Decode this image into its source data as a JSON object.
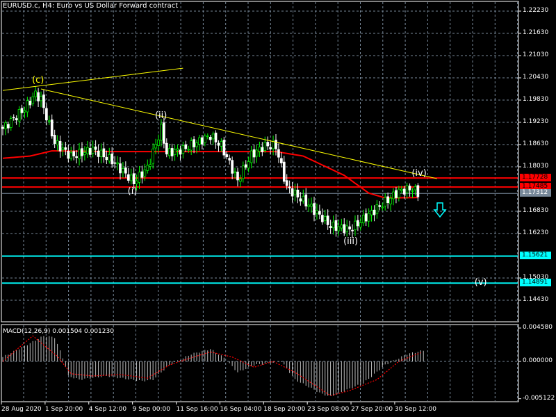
{
  "header": {
    "title": "EURUSD.c, H4:  Euro vs US Dollar Forward contract"
  },
  "colors": {
    "bull": "#00ff00",
    "bear": "#ffffff",
    "ma": "#ff0000",
    "trend": "#ffff00",
    "support": "#00ffff",
    "level": "#ff0000",
    "bid": "#778899",
    "grid": "#778899"
  },
  "price_axis": [
    "1.22230",
    "1.21630",
    "1.21030",
    "1.20430",
    "1.19830",
    "1.19230",
    "1.18630",
    "1.18030",
    "1.16830",
    "1.16230",
    "1.15030",
    "1.14430"
  ],
  "price_axis_values": [
    1.2223,
    1.2163,
    1.2103,
    1.2043,
    1.1983,
    1.1923,
    1.1863,
    1.1803,
    1.1683,
    1.1623,
    1.1503,
    1.1443
  ],
  "levels": [
    {
      "label": "1.17728",
      "value": 1.17728,
      "kind": "level"
    },
    {
      "label": "1.17485",
      "value": 1.17485,
      "kind": "level"
    },
    {
      "label": "1.17312",
      "value": 1.17312,
      "kind": "bid"
    },
    {
      "label": "1.15621",
      "value": 1.15621,
      "kind": "support"
    },
    {
      "label": "1.14891",
      "value": 1.14891,
      "kind": "support"
    }
  ],
  "waves": [
    {
      "label": "(c)",
      "bar": 13,
      "price": 1.2035,
      "color": "#ffff00"
    },
    {
      "label": "(ii)",
      "bar": 58,
      "price": 1.194,
      "color": "#ffffff"
    },
    {
      "label": "(i)",
      "bar": 48,
      "price": 1.1735,
      "color": "#ffffff"
    },
    {
      "label": "(iii)",
      "bar": 127,
      "price": 1.16,
      "color": "#ffffff"
    },
    {
      "label": "(iv)",
      "bar": 152,
      "price": 1.1785,
      "color": "#ffffff"
    },
    {
      "label": "(v)",
      "bar": 175,
      "price": 1.149,
      "color": "#ffffff"
    }
  ],
  "macd": {
    "label": "MACD(12,26,9) 0.001504 0.001230",
    "axis": [
      "0.004580",
      "0.000000",
      "-0.005122"
    ],
    "axis_values": [
      0.00458,
      0,
      -0.005122
    ]
  },
  "time_axis": [
    {
      "label": "28 Aug 2020",
      "bar": 0
    },
    {
      "label": "1 Sep 20:00",
      "bar": 16
    },
    {
      "label": "4 Sep 12:00",
      "bar": 32
    },
    {
      "label": "9 Sep 00:00",
      "bar": 48
    },
    {
      "label": "11 Sep 16:00",
      "bar": 64
    },
    {
      "label": "16 Sep 04:00",
      "bar": 80
    },
    {
      "label": "18 Sep 20:00",
      "bar": 96
    },
    {
      "label": "23 Sep 08:00",
      "bar": 112
    },
    {
      "label": "27 Sep 20:00",
      "bar": 128
    },
    {
      "label": "30 Sep 12:00",
      "bar": 144
    }
  ],
  "chart_data": {
    "type": "candlestick",
    "symbol": "EURUSD.c",
    "timeframe": "H4",
    "ylim": [
      1.1413,
      1.2253
    ],
    "close_anchors": [
      [
        0,
        1.1906
      ],
      [
        8,
        1.196
      ],
      [
        12,
        1.2
      ],
      [
        14,
        1.1985
      ],
      [
        19,
        1.1869
      ],
      [
        25,
        1.1831
      ],
      [
        33,
        1.185
      ],
      [
        40,
        1.182
      ],
      [
        48,
        1.1762
      ],
      [
        53,
        1.18
      ],
      [
        58,
        1.1906
      ],
      [
        60,
        1.184
      ],
      [
        66,
        1.185
      ],
      [
        76,
        1.1887
      ],
      [
        80,
        1.186
      ],
      [
        86,
        1.1766
      ],
      [
        91,
        1.1835
      ],
      [
        96,
        1.186
      ],
      [
        100,
        1.1859
      ],
      [
        104,
        1.1747
      ],
      [
        112,
        1.17
      ],
      [
        120,
        1.1644
      ],
      [
        127,
        1.1634
      ],
      [
        130,
        1.165
      ],
      [
        137,
        1.1691
      ],
      [
        145,
        1.1737
      ],
      [
        150,
        1.1745
      ],
      [
        152,
        1.1731
      ]
    ],
    "ma_anchors": [
      [
        0,
        1.1826
      ],
      [
        10,
        1.1832
      ],
      [
        18,
        1.1846
      ],
      [
        40,
        1.1844
      ],
      [
        100,
        1.1844
      ],
      [
        110,
        1.1832
      ],
      [
        125,
        1.178
      ],
      [
        134,
        1.1732
      ],
      [
        140,
        1.1719
      ],
      [
        152,
        1.172
      ]
    ],
    "trendlines": [
      [
        [
          0,
          1.2009
        ],
        [
          66,
          1.2069
        ]
      ],
      [
        [
          14,
          1.2013
        ],
        [
          159,
          1.1771
        ]
      ]
    ],
    "macd_anchors": [
      [
        0,
        0.0006
      ],
      [
        10,
        0.0025
      ],
      [
        15,
        0.0035
      ],
      [
        19,
        0.0033
      ],
      [
        22,
        0.0005
      ],
      [
        24,
        -0.002
      ],
      [
        28,
        -0.0025
      ],
      [
        38,
        -0.002
      ],
      [
        51,
        -0.0027
      ],
      [
        55,
        -0.0025
      ],
      [
        61,
        -0.0005
      ],
      [
        69,
        0.001
      ],
      [
        76,
        0.0017
      ],
      [
        81,
        0.0005
      ],
      [
        86,
        -0.0015
      ],
      [
        92,
        -0.0005
      ],
      [
        102,
        0.0
      ],
      [
        107,
        -0.0025
      ],
      [
        117,
        -0.0045
      ],
      [
        120,
        -0.0048
      ],
      [
        132,
        -0.003
      ],
      [
        140,
        -0.0005
      ],
      [
        148,
        0.001
      ],
      [
        154,
        0.0015
      ]
    ],
    "signal_anchors": [
      [
        0,
        0.0
      ],
      [
        11,
        0.0035
      ],
      [
        20,
        0.0007
      ],
      [
        25,
        -0.0017
      ],
      [
        33,
        -0.002
      ],
      [
        43,
        -0.0018
      ],
      [
        53,
        -0.0023
      ],
      [
        61,
        -0.0005
      ],
      [
        69,
        0.0005
      ],
      [
        76,
        0.0013
      ],
      [
        84,
        0.0006
      ],
      [
        92,
        -0.0008
      ],
      [
        99,
        0.0
      ],
      [
        107,
        -0.0015
      ],
      [
        120,
        -0.0047
      ],
      [
        127,
        -0.004
      ],
      [
        137,
        -0.0025
      ],
      [
        145,
        0.0
      ],
      [
        153,
        0.0012
      ]
    ]
  }
}
